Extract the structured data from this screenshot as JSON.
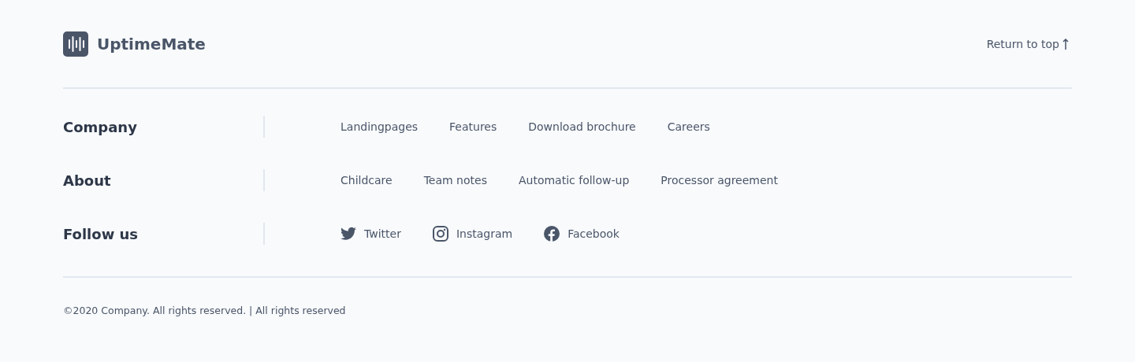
{
  "brand": {
    "name": "UptimeMate"
  },
  "return_link": {
    "label": "Return to top"
  },
  "sections": [
    {
      "title": "Company",
      "links": [
        {
          "label": "Landingpages"
        },
        {
          "label": "Features"
        },
        {
          "label": "Download brochure"
        },
        {
          "label": "Careers"
        }
      ]
    },
    {
      "title": "About",
      "links": [
        {
          "label": "Childcare"
        },
        {
          "label": "Team notes"
        },
        {
          "label": "Automatic follow-up"
        },
        {
          "label": "Processor agreement"
        }
      ]
    },
    {
      "title": "Follow us",
      "links": [
        {
          "label": "Twitter",
          "kind": "twitter"
        },
        {
          "label": "Instagram",
          "kind": "instagram"
        },
        {
          "label": "Facebook",
          "kind": "facebook"
        }
      ]
    }
  ],
  "copyright": "©2020 Company. All rights reserved. | All rights reserved"
}
